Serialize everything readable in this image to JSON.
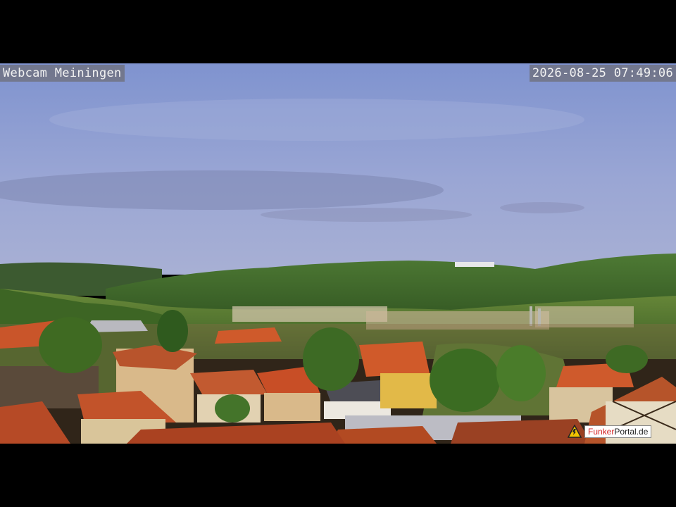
{
  "webcam": {
    "title": "Webcam Meiningen",
    "timestamp": "2026-08-25 07:49:06"
  },
  "logo": {
    "brand_red": "Funker",
    "brand_rest": "Portal.de"
  },
  "colors": {
    "sky_top": "#8f9fd6",
    "sky_bottom": "#9aa8d2",
    "hills": "#3f6a2a",
    "roof": "#c8502a",
    "logo_accent": "#d22020"
  }
}
